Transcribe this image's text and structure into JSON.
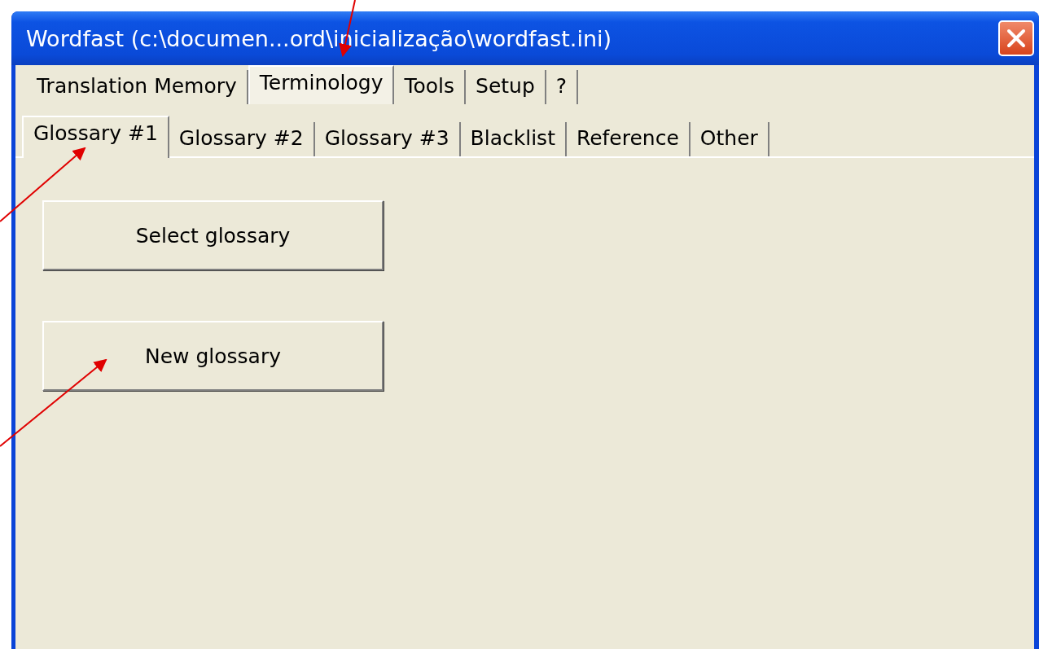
{
  "window": {
    "title": "Wordfast (c:\\documen...ord\\inicialização\\wordfast.ini)"
  },
  "tabs": [
    {
      "label": "Translation Memory",
      "selected": false
    },
    {
      "label": "Terminology",
      "selected": true
    },
    {
      "label": "Tools",
      "selected": false
    },
    {
      "label": "Setup",
      "selected": false
    },
    {
      "label": "?",
      "selected": false
    }
  ],
  "subtabs": [
    {
      "label": "Glossary #1",
      "selected": true
    },
    {
      "label": "Glossary #2",
      "selected": false
    },
    {
      "label": "Glossary #3",
      "selected": false
    },
    {
      "label": "Blacklist",
      "selected": false
    },
    {
      "label": "Reference",
      "selected": false
    },
    {
      "label": "Other",
      "selected": false
    }
  ],
  "buttons": [
    {
      "label": "Select glossary"
    },
    {
      "label": "New glossary"
    }
  ]
}
